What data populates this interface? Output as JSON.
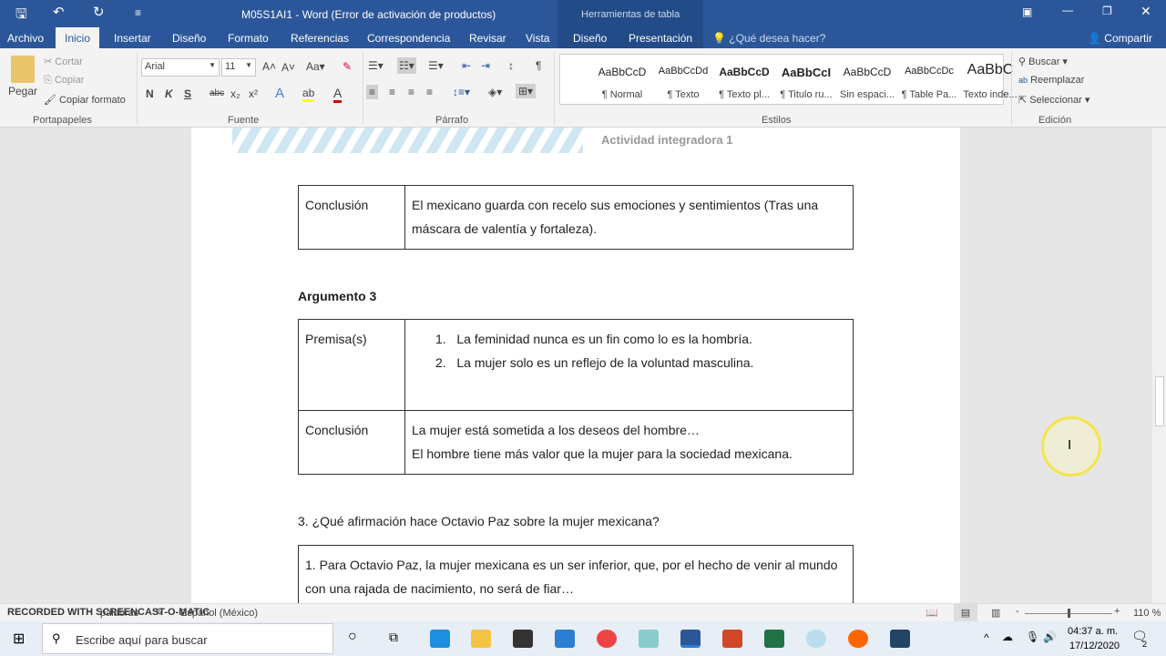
{
  "window": {
    "title": "M05S1AI1 - Word (Error de activación de productos)",
    "context_tab": "Herramientas de tabla"
  },
  "tabs": [
    "Archivo",
    "Inicio",
    "Insertar",
    "Diseño",
    "Formato",
    "Referencias",
    "Correspondencia",
    "Revisar",
    "Vista",
    "Diseño",
    "Presentación"
  ],
  "tell_me": "¿Qué desea hacer?",
  "share": "Compartir",
  "clipboard": {
    "paste": "Pegar",
    "cut": "Cortar",
    "copy": "Copiar",
    "format_painter": "Copiar formato",
    "group": "Portapapeles"
  },
  "font": {
    "name": "Arial",
    "size": "11",
    "bold": "N",
    "italic": "K",
    "underline": "S",
    "group": "Fuente"
  },
  "paragraph": {
    "group": "Párrafo"
  },
  "styles": {
    "group": "Estilos",
    "items": [
      {
        "preview": "AaBbCcD",
        "name": "¶ Normal"
      },
      {
        "preview": "AaBbCcDd",
        "name": "¶ Texto"
      },
      {
        "preview": "AaBbCcD",
        "name": "¶ Texto pl..."
      },
      {
        "preview": "AaBbCcI",
        "name": "¶ Titulo ru..."
      },
      {
        "preview": "AaBbCcD",
        "name": "Sin espaci..."
      },
      {
        "preview": "AaBbCcDc",
        "name": "¶ Table Pa..."
      },
      {
        "preview": "AaBbC",
        "name": "Texto inde..."
      }
    ]
  },
  "editing": {
    "find": "Buscar",
    "replace": "Reemplazar",
    "select": "Seleccionar",
    "group": "Edición"
  },
  "document": {
    "header": "Actividad integradora 1",
    "table1": {
      "label": "Conclusión",
      "text": "El mexicano guarda con recelo sus emociones y sentimientos (Tras una máscara de valentía y fortaleza)."
    },
    "heading": "Argumento 3",
    "table2": {
      "premise_label": "Premisa(s)",
      "premises": [
        "La feminidad nunca es un fin como lo es la hombría.",
        "La mujer solo es un reflejo de la voluntad masculina."
      ],
      "conclusion_label": "Conclusión",
      "conclusion_lines": [
        "La mujer está sometida a los deseos del hombre…",
        "El hombre tiene más valor que la mujer para la sociedad mexicana."
      ]
    },
    "question": "3. ¿Qué afirmación hace Octavio Paz sobre la mujer mexicana?",
    "answer": "1. Para Octavio Paz, la mujer mexicana es un ser inferior, que, por el hecho de venir al mundo con una rajada de nacimiento, no será de fiar…"
  },
  "status": {
    "words": "palabras",
    "language": "Español (México)",
    "zoom": "110 %",
    "watermark": "RECORDED WITH SCREENCAST-O-MATIC"
  },
  "taskbar": {
    "search_placeholder": "Escribe aquí para buscar",
    "time": "04:37 a. m.",
    "date": "17/12/2020",
    "notifications": "2"
  }
}
